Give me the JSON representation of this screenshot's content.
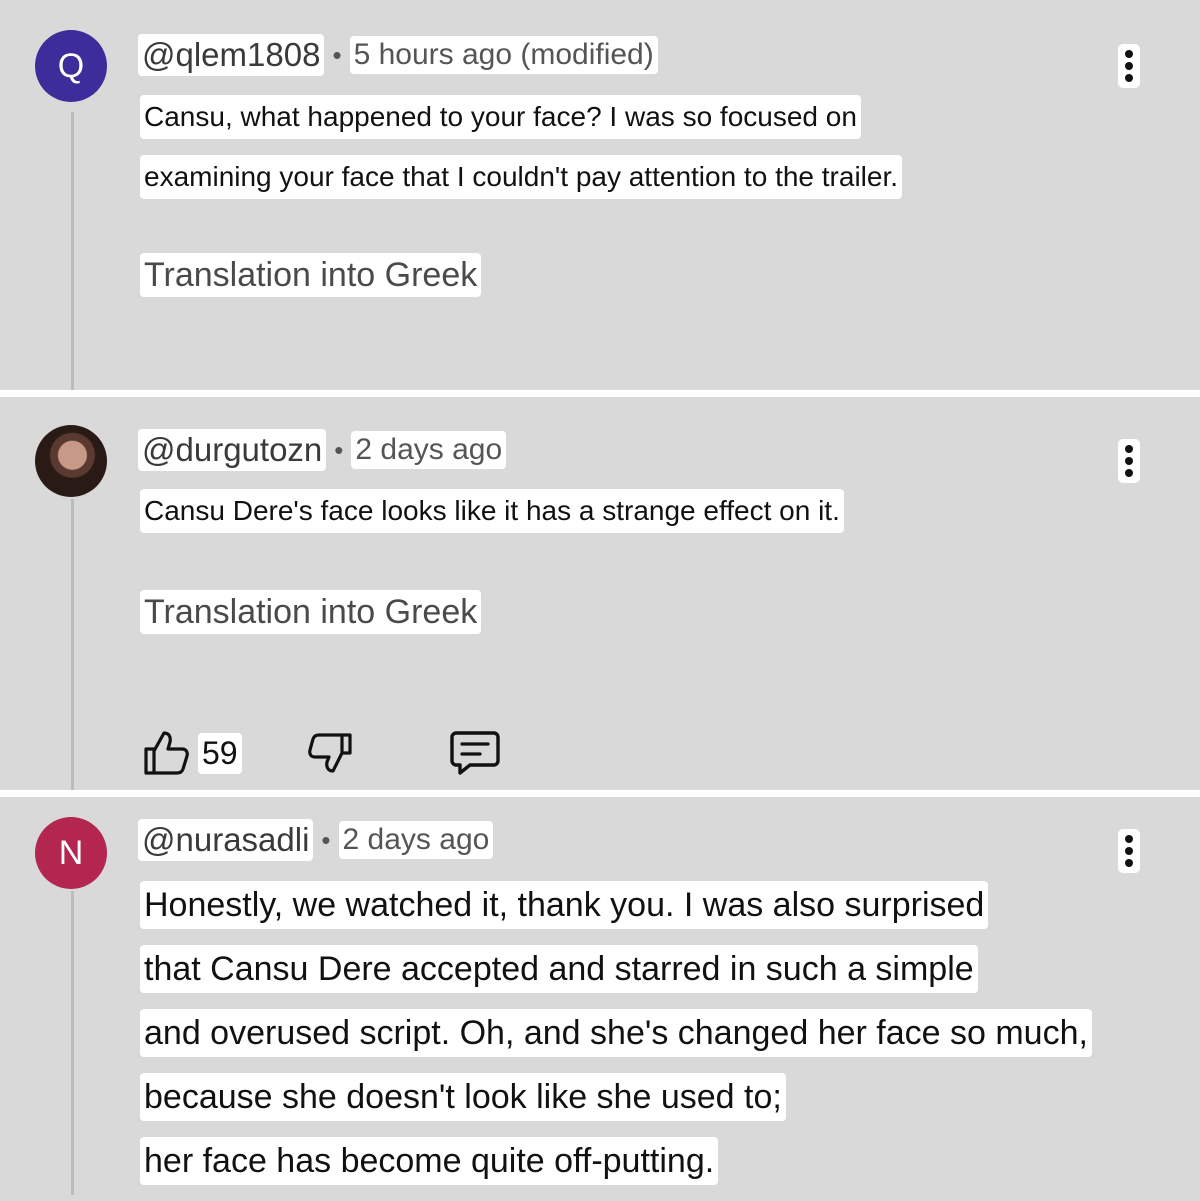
{
  "comments": [
    {
      "avatar_letter": "Q",
      "avatar_color": "#3d2d9a",
      "handle": "@qlem1808",
      "separator": "•",
      "time": "5 hours ago (modified)",
      "body": [
        "Cansu, what happened to your face? I was so focused on",
        "examining your face that I couldn't pay attention to the trailer."
      ],
      "translate_label": "Translation into Greek",
      "menu_icon": "kebab-menu-icon"
    },
    {
      "avatar_letter": "",
      "avatar_color": "#3a2420",
      "handle": "@durgutozn",
      "separator": "•",
      "time": "2 days ago",
      "body": [
        "Cansu Dere's face looks like it has a strange effect on it."
      ],
      "translate_label": "Translation into Greek",
      "likes": "59",
      "action_icons": [
        "thumbs-up-icon",
        "thumbs-down-icon",
        "reply-icon"
      ],
      "menu_icon": "kebab-menu-icon"
    },
    {
      "avatar_letter": "N",
      "avatar_color": "#b3264f",
      "handle": "@nurasadli",
      "separator": "•",
      "time": "2 days ago",
      "body": [
        "Honestly, we watched it, thank you. I was also surprised",
        "that Cansu Dere accepted and starred in such a simple",
        "and overused script. Oh, and she's changed her face so much,",
        "because she doesn't look like she used to;",
        "her face has become quite off-putting."
      ],
      "menu_icon": "kebab-menu-icon"
    }
  ]
}
